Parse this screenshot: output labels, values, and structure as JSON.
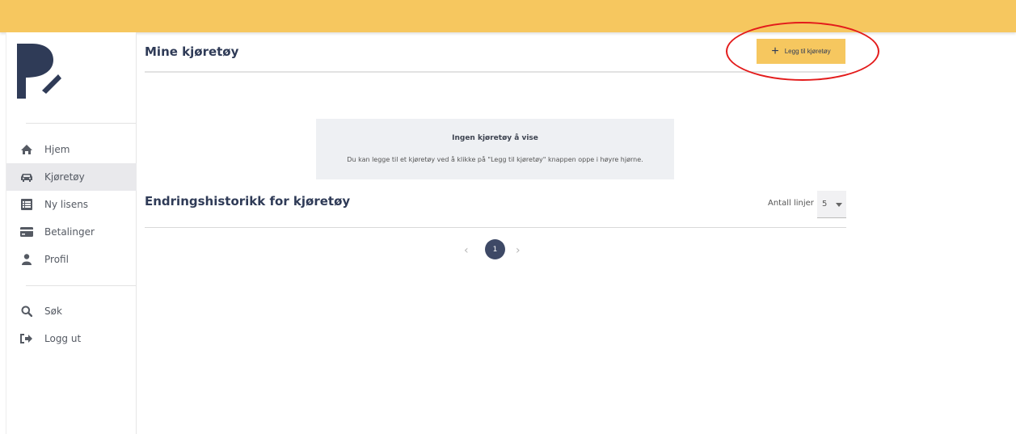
{
  "sidebar": {
    "items": [
      {
        "label": "Hjem",
        "icon": "home-icon"
      },
      {
        "label": "Kjøretøy",
        "icon": "car-icon"
      },
      {
        "label": "Ny lisens",
        "icon": "list-icon"
      },
      {
        "label": "Betalinger",
        "icon": "credit-card-icon"
      },
      {
        "label": "Profil",
        "icon": "user-icon"
      }
    ],
    "bottom_items": [
      {
        "label": "Søk",
        "icon": "search-icon"
      },
      {
        "label": "Logg ut",
        "icon": "logout-icon"
      }
    ],
    "active": "Kjøretøy"
  },
  "main": {
    "title": "Mine kjøretøy",
    "add_button_label": "Legg til kjøretøy",
    "empty_state": {
      "title": "Ingen kjøretøy å vise",
      "text": "Du kan legge til et kjøretøy ved å klikke på \"Legg til kjøretøy\" knappen oppe i høyre hjørne."
    },
    "history": {
      "title": "Endringshistorikk for kjøretøy",
      "lines_label": "Antall linjer",
      "lines_value": "5"
    },
    "pagination": {
      "current": "1"
    }
  },
  "colors": {
    "accent": "#f6c75f",
    "brand": "#2f3b57",
    "annotation": "#e31b1b"
  }
}
